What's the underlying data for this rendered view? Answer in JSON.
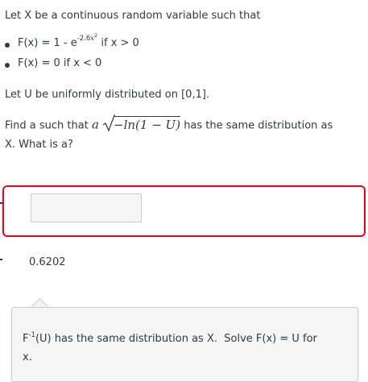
{
  "question": {
    "intro": "Let X be a continuous random variable such that",
    "bullet1_prefix": "F(x) = 1 - e",
    "bullet1_exp_num": "-2.6",
    "bullet1_exp_var": "x",
    "bullet1_exp_pow": "2",
    "bullet1_suffix": " if x > 0",
    "bullet2": "F(x) = 0 if x < 0",
    "uniform": "Let U be uniformly distributed on [0,1].",
    "find_prefix": "Find a such that ",
    "find_math_a": "a",
    "find_math_radicand": "−ln(1 − U)",
    "find_suffix": " has the same distribution as",
    "find_line2": "X. What is a?"
  },
  "answer": {
    "input_value": "",
    "correct_value": "0.6202"
  },
  "comment": {
    "pre": "F",
    "sup": "-1",
    "post": "(U) has the same distribution as X.  Solve F(x) = U for",
    "line2": "x."
  },
  "colors": {
    "text": "#2d3b45",
    "error_border": "#e0061f",
    "input_bg": "#f5f5f5",
    "comment_bg": "#f5f5f5",
    "border_gray": "#c7cdd1"
  }
}
